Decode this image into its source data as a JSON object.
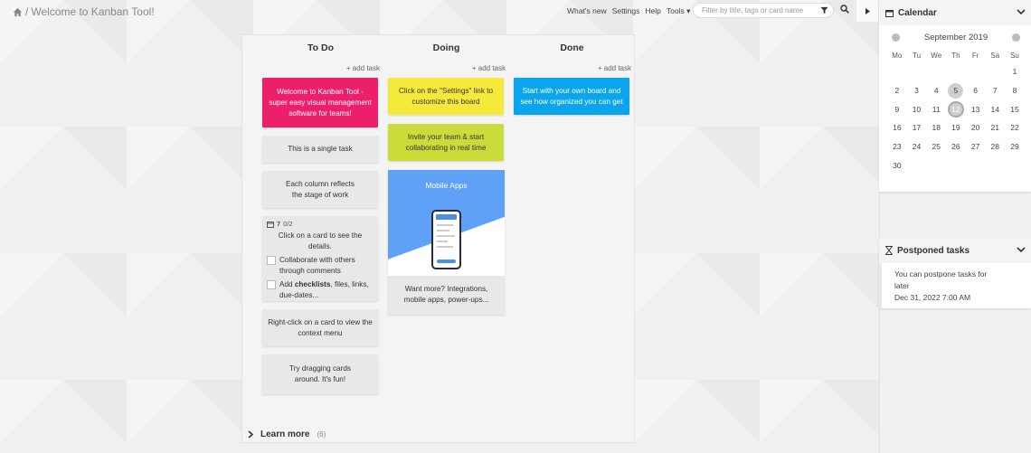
{
  "header": {
    "title": "Welcome to Kanban Tool!",
    "separator": "/",
    "links": [
      "What's new",
      "Settings",
      "Help",
      "Tools"
    ],
    "search_placeholder": "Filter by title, tags or card name"
  },
  "board": {
    "columns": [
      {
        "name": "To Do",
        "add_label": "+ add task"
      },
      {
        "name": "Doing",
        "add_label": "+ add task"
      },
      {
        "name": "Done",
        "add_label": "+ add task"
      }
    ],
    "todo_cards": [
      {
        "text": "Welcome to Kanban Tool - super easy visual management software for teams!",
        "color": "#ec1f6b"
      },
      {
        "text": "This is a single task",
        "color": "#e8e8e8"
      },
      {
        "text": "Each column reflects the stage of work",
        "color": "#e8e8e8"
      },
      {
        "text": "Right-click on a card to view the context menu",
        "color": "#e8e8e8"
      },
      {
        "text": "Try dragging cards around. It's fun!",
        "color": "#e8e8e8"
      }
    ],
    "checklist_card": {
      "date_num": "7",
      "progress": "0/2",
      "title": "Click on a card to see the details.",
      "items": [
        {
          "text": "Collaborate with others through comments",
          "checked": false
        },
        {
          "prefix": "Add ",
          "bold": "checklists",
          "suffix": ", files, links, due-dates...",
          "checked": false
        }
      ]
    },
    "doing_cards": [
      {
        "text": "Click on the \"Settings\" link to customize this board",
        "color": "#f5ea3a"
      },
      {
        "text": "Invite your team & start collaborating in real time",
        "color": "#c9dc3a"
      }
    ],
    "image_card": {
      "image_title": "Mobile Apps",
      "caption": "Want more? Integrations, mobile apps, power-ups..."
    },
    "done_cards": [
      {
        "text": "Start with your own board and see how organized you can get",
        "color": "#0aa5ec"
      }
    ],
    "learn_more": {
      "label": "Learn more",
      "count": "(6)"
    }
  },
  "calendar": {
    "title": "Calendar",
    "month": "September 2019",
    "weekdays": [
      "Mo",
      "Tu",
      "We",
      "Th",
      "Fr",
      "Sa",
      "Su"
    ],
    "days": [
      "",
      "",
      "",
      "",
      "",
      "",
      "1",
      "2",
      "3",
      "4",
      "5",
      "6",
      "7",
      "8",
      "9",
      "10",
      "11",
      "12",
      "13",
      "14",
      "15",
      "16",
      "17",
      "18",
      "19",
      "20",
      "21",
      "22",
      "23",
      "24",
      "25",
      "26",
      "27",
      "28",
      "29",
      "30"
    ],
    "marked_day": "5",
    "today": "12"
  },
  "postponed": {
    "title": "Postponed tasks",
    "text": "You can postpone tasks for later",
    "date": "Dec 31, 2022 7:00 AM"
  }
}
